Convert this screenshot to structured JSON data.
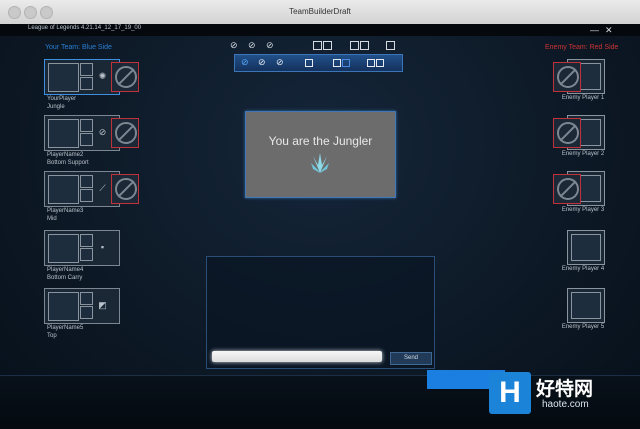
{
  "window": {
    "title": "TeamBuilderDraft"
  },
  "client": {
    "title": "League of Legends 4.21.14_12_17_19_00",
    "minimize": "—",
    "close": "✕"
  },
  "your_team": {
    "label": "Your Team: Blue Side",
    "players": [
      {
        "name": "YourPlayer",
        "role": "Jungle"
      },
      {
        "name": "PlayerName2",
        "role": "Bottom Support"
      },
      {
        "name": "PlayerName3",
        "role": "Mid"
      },
      {
        "name": "PlayerName4",
        "role": "Bottom Carry"
      },
      {
        "name": "PlayerName5",
        "role": "Top"
      }
    ]
  },
  "enemy_team": {
    "label": "Enemy Team: Red Side",
    "players": [
      "Enemy Player 1",
      "Enemy Player 2",
      "Enemy Player 3",
      "Enemy Player 4",
      "Enemy Player 5"
    ]
  },
  "notice": {
    "text": "You are the Jungler"
  },
  "chat": {
    "input_value": "",
    "send_label": "Send"
  },
  "watermark": {
    "logo": "H",
    "text": "好特网",
    "sub": "haote.com"
  },
  "colors": {
    "blue_side": "#2a7fd4",
    "red_side": "#cc3333",
    "accent": "#1a7fe0"
  }
}
